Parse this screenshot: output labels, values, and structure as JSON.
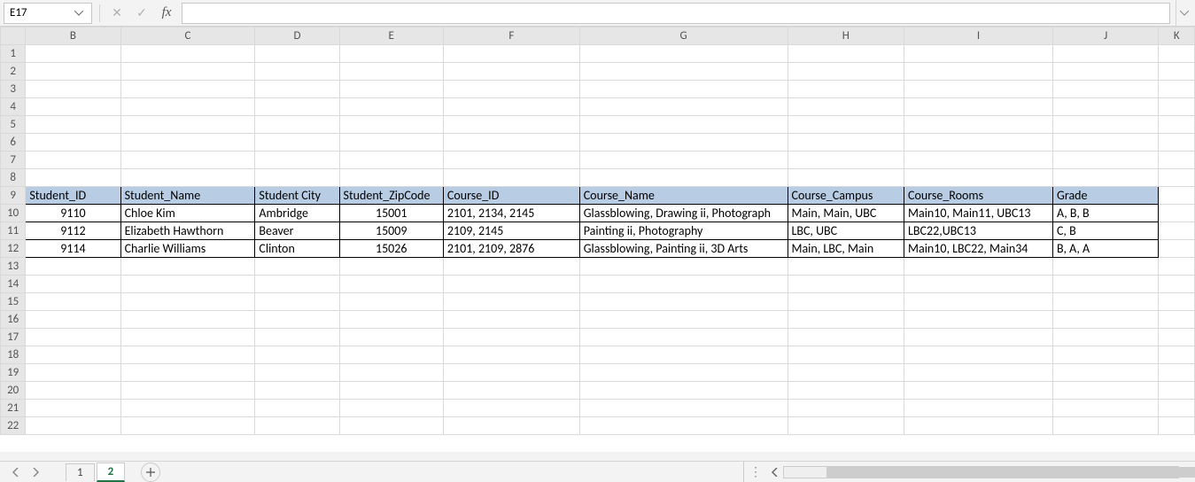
{
  "namebox": {
    "value": "E17"
  },
  "fx": {
    "cancel": "✕",
    "confirm": "✓",
    "label": "fx"
  },
  "columns": [
    "B",
    "C",
    "D",
    "E",
    "F",
    "G",
    "H",
    "I",
    "J",
    "K"
  ],
  "rows": [
    "1",
    "2",
    "3",
    "4",
    "5",
    "6",
    "7",
    "8",
    "9",
    "10",
    "11",
    "12",
    "13",
    "14",
    "15",
    "16",
    "17",
    "18",
    "19",
    "20",
    "21",
    "22"
  ],
  "headers": {
    "B": "Student_ID",
    "C": "Student_Name",
    "D": "Student City",
    "E": "Student_ZipCode",
    "F": "Course_ID",
    "G": "Course_Name",
    "H": "Course_Campus",
    "I": "Course_Rooms",
    "J": "Grade"
  },
  "dataRows": [
    {
      "B": "9110",
      "C": "Chloe Kim",
      "D": "Ambridge",
      "E": "15001",
      "F": "2101, 2134, 2145",
      "G": "Glassblowing, Drawing ii, Photograph",
      "H": "Main, Main, UBC",
      "I": "Main10, Main11, UBC13",
      "J": "A, B, B"
    },
    {
      "B": "9112",
      "C": "Elizabeth Hawthorn",
      "D": "Beaver",
      "E": "15009",
      "F": "2109, 2145",
      "G": "Painting ii, Photography",
      "H": "LBC, UBC",
      "I": "LBC22,UBC13",
      "J": "C, B"
    },
    {
      "B": "9114",
      "C": "Charlie Williams",
      "D": "Clinton",
      "E": "15026",
      "F": "2101, 2109, 2876",
      "G": "Glassblowing, Painting ii, 3D Arts",
      "H": "Main, LBC, Main",
      "I": "Main10, LBC22, Main34",
      "J": "B, A, A"
    }
  ],
  "tabs": {
    "t1": "1",
    "t2": "2"
  }
}
